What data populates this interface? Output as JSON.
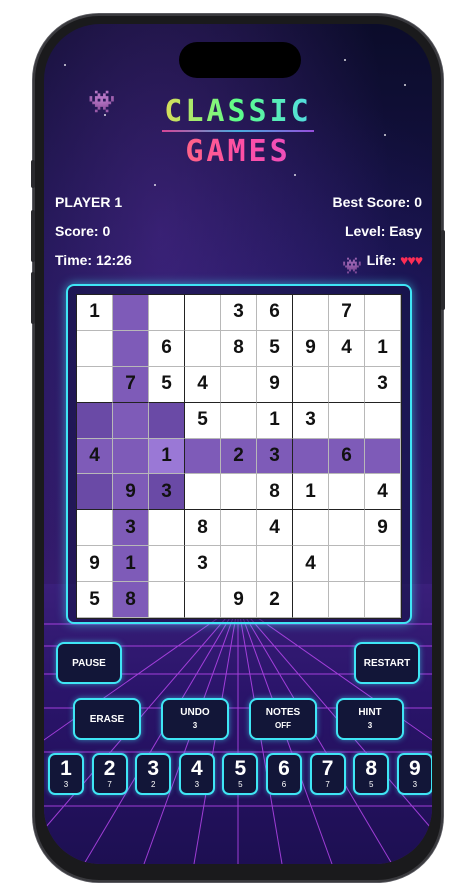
{
  "header": {
    "logo_line1": "CLASSIC",
    "logo_line2": "GAMES",
    "player": "PLAYER 1",
    "best_score": "Best Score: 0",
    "score": "Score: 0",
    "level": "Level: Easy",
    "time": "Time: 12:26",
    "life_label": "Life: ",
    "life_hearts": "♥♥♥"
  },
  "board": [
    [
      "1",
      "",
      "",
      "",
      "3",
      "6",
      "",
      "7",
      ""
    ],
    [
      "",
      "",
      "6",
      "",
      "8",
      "5",
      "9",
      "4",
      "1"
    ],
    [
      "",
      "7",
      "5",
      "4",
      "",
      "9",
      "",
      "",
      "3"
    ],
    [
      "",
      "",
      "",
      "5",
      "",
      "1",
      "3",
      "",
      ""
    ],
    [
      "4",
      "",
      "1",
      "",
      "2",
      "3",
      "",
      "6",
      ""
    ],
    [
      "",
      "9",
      "3",
      "",
      "",
      "8",
      "1",
      "",
      "4"
    ],
    [
      "",
      "3",
      "",
      "8",
      "",
      "4",
      "",
      "",
      "9"
    ],
    [
      "9",
      "1",
      "",
      "3",
      "",
      "",
      "4",
      "",
      ""
    ],
    [
      "5",
      "8",
      "",
      "",
      "9",
      "2",
      "",
      "",
      ""
    ]
  ],
  "selected_cell": {
    "row": 4,
    "col": 2
  },
  "controls": {
    "pause": "PAUSE",
    "restart": "RESTART",
    "erase": "ERASE",
    "undo": "UNDO",
    "undo_count": "3",
    "notes": "NOTES",
    "notes_state": "OFF",
    "hint": "HINT",
    "hint_count": "3"
  },
  "number_pad": [
    {
      "n": "1",
      "c": "3"
    },
    {
      "n": "2",
      "c": "7"
    },
    {
      "n": "3",
      "c": "2"
    },
    {
      "n": "4",
      "c": "3"
    },
    {
      "n": "5",
      "c": "5"
    },
    {
      "n": "6",
      "c": "6"
    },
    {
      "n": "7",
      "c": "7"
    },
    {
      "n": "8",
      "c": "5"
    },
    {
      "n": "9",
      "c": "3"
    }
  ],
  "colors": {
    "accent": "#3fe6f5",
    "highlight": "#7e5bb8",
    "heart": "#ff2d55"
  }
}
